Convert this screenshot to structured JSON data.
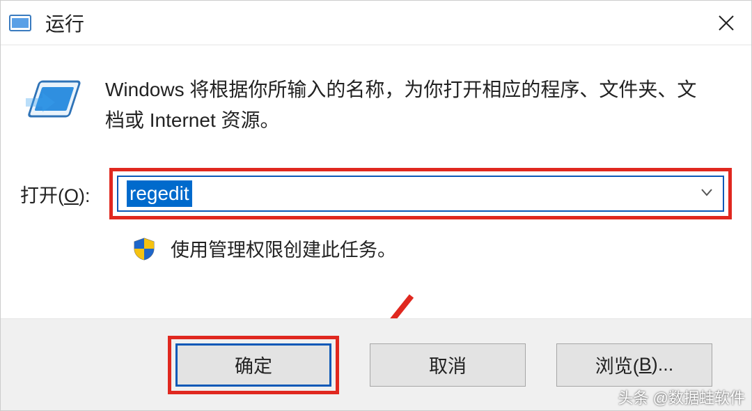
{
  "titlebar": {
    "title": "运行"
  },
  "description": "Windows 将根据你所输入的名称，为你打开相应的程序、文件夹、文档或 Internet 资源。",
  "open": {
    "label_prefix": "打开(",
    "label_accel": "O",
    "label_suffix": "):",
    "value": "regedit"
  },
  "admin_note": "使用管理权限创建此任务。",
  "buttons": {
    "ok": "确定",
    "cancel": "取消",
    "browse_prefix": "浏览(",
    "browse_accel": "B",
    "browse_suffix": ")..."
  },
  "watermark": "头条 @数据蛙软件"
}
